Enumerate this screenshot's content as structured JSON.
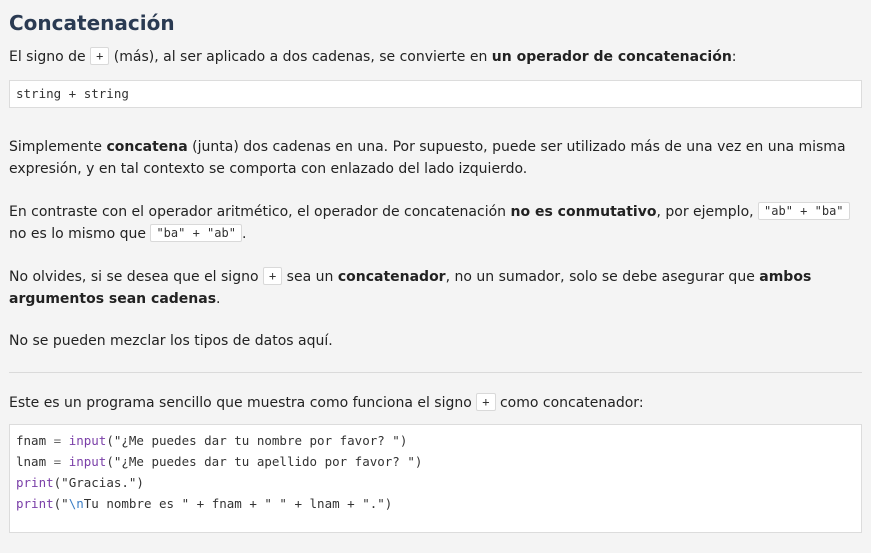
{
  "title": "Concatenación",
  "intro": {
    "before": "El signo de",
    "sign": "+",
    "after": "(más), al ser aplicado a dos cadenas, se convierte en",
    "bold": "un operador de concatenación",
    "end": ":"
  },
  "syntax_code": "string + string",
  "para1": {
    "before": "Simplemente",
    "bold": "concatena",
    "after": "(junta) dos cadenas en una. Por supuesto, puede ser utilizado más de una vez en una misma expresión, y en tal contexto se comporta con enlazado del lado izquierdo."
  },
  "para2": {
    "before": "En contraste con el operador aritmético, el operador de concatenación",
    "bold": "no es conmutativo",
    "middle": ", por ejemplo,",
    "code1": "\"ab\" + \"ba\"",
    "between": "no es lo mismo que",
    "code2": "\"ba\" + \"ab\"",
    "end": "."
  },
  "para3": {
    "before": "No olvides, si se desea que el signo",
    "sign": "+",
    "mid1": "sea un",
    "bold1": "concatenador",
    "mid2": ", no un sumador, solo se debe asegurar que",
    "bold2": "ambos argumentos sean cadenas",
    "end": "."
  },
  "para4": "No se pueden mezclar los tipos de datos aquí.",
  "para5": {
    "before": "Este es un programa sencillo que muestra como funciona el signo",
    "sign": "+",
    "after": "como concatenador:"
  },
  "program": {
    "l1_var": "fnam",
    "l1_eq": " = ",
    "l1_fn": "input",
    "l1_str": "(\"¿Me puedes dar tu nombre por favor? \")",
    "l2_var": "lnam",
    "l2_eq": " = ",
    "l2_fn": "input",
    "l2_str": "(\"¿Me puedes dar tu apellido por favor? \")",
    "l3_fn": "print",
    "l3_str": "(\"Gracias.\")",
    "l4_fn": "print",
    "l4_open": "(\"",
    "l4_esc": "\\n",
    "l4_rest": "Tu nombre es \" + fnam + \" \" + lnam + \".\")"
  }
}
